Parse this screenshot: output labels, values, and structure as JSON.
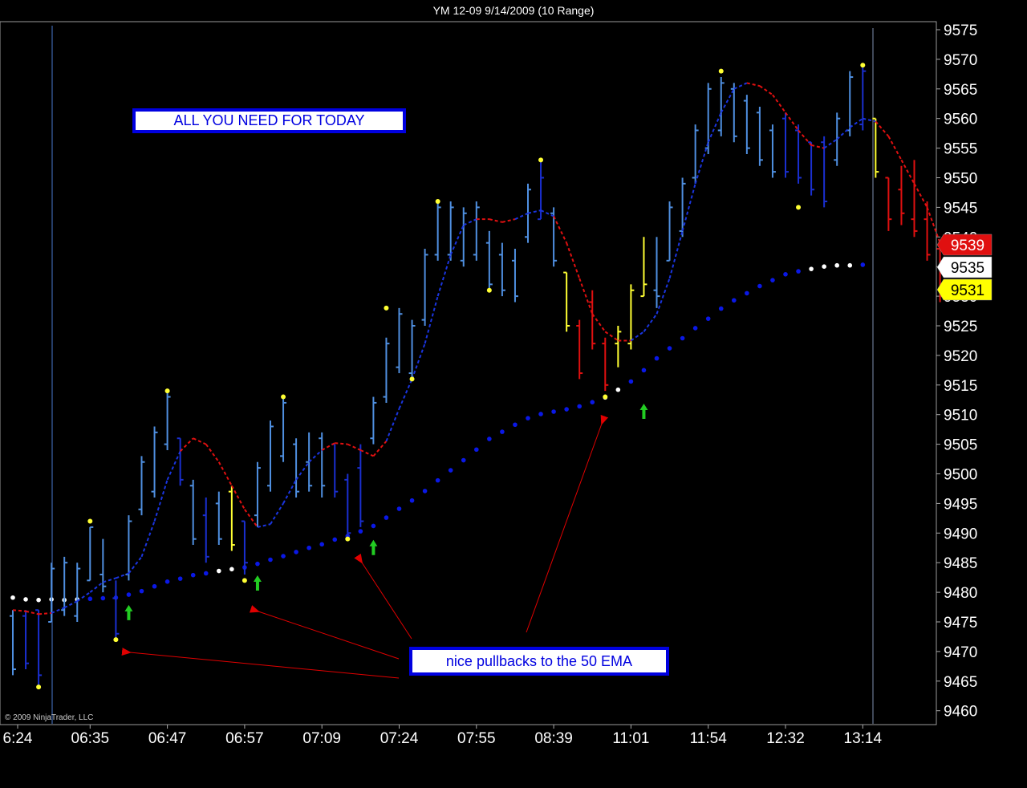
{
  "header": {
    "title": "YM 12-09  9/14/2009 (10 Range)"
  },
  "copyright": "© 2009 NinjaTrader, LLC",
  "annotations": {
    "headline": "ALL YOU NEED FOR TODAY",
    "pullback_note": "nice pullbacks to the 50 EMA"
  },
  "colors": {
    "background": "#000000",
    "up_bar": "#4f8fe0",
    "down_bar": "#1a2fd0",
    "red_bar": "#e01010",
    "yellow_bar": "#ffff33",
    "fast_ma_up": "#1a35e0",
    "fast_ma_down": "#e01010",
    "ema50_dots": "#0a18e6",
    "ema50_flat_dots": "#ffffff",
    "arrow_up": "#22cc22",
    "annotation_arrow": "#e00000",
    "marker_swing": "#ffff33"
  },
  "chart_data": {
    "type": "ohlc",
    "instrument": "YM 12-09",
    "ylim": [
      9460,
      9575
    ],
    "y_ticks": [
      9460,
      9465,
      9470,
      9475,
      9480,
      9485,
      9490,
      9495,
      9500,
      9505,
      9510,
      9515,
      9520,
      9525,
      9530,
      9535,
      9540,
      9545,
      9550,
      9555,
      9560,
      9565,
      9570,
      9575
    ],
    "x_ticks": [
      {
        "label": "6:24",
        "bar": 0
      },
      {
        "label": "06:35",
        "bar": 6
      },
      {
        "label": "06:47",
        "bar": 12
      },
      {
        "label": "06:57",
        "bar": 18
      },
      {
        "label": "07:09",
        "bar": 24
      },
      {
        "label": "07:24",
        "bar": 30
      },
      {
        "label": "07:55",
        "bar": 36
      },
      {
        "label": "08:39",
        "bar": 42
      },
      {
        "label": "11:01",
        "bar": 48
      },
      {
        "label": "11:54",
        "bar": 54
      },
      {
        "label": "12:32",
        "bar": 60
      },
      {
        "label": "13:14",
        "bar": 66
      }
    ],
    "price_markers": [
      {
        "value": 9539,
        "color": "#e01010",
        "text_color": "#ffffff"
      },
      {
        "value": 9535,
        "color": "#ffffff",
        "text_color": "#000000"
      },
      {
        "value": 9531,
        "color": "#ffff00",
        "text_color": "#000000"
      }
    ],
    "bars": [
      {
        "o": 9476,
        "h": 9477,
        "l": 9466,
        "c": 9467,
        "color": "up"
      },
      {
        "o": 9476,
        "h": 9477,
        "l": 9467,
        "c": 9468,
        "color": "down"
      },
      {
        "o": 9477,
        "h": 9477,
        "l": 9464,
        "c": 9466,
        "color": "down"
      },
      {
        "o": 9475,
        "h": 9485,
        "l": 9475,
        "c": 9484,
        "color": "up"
      },
      {
        "o": 9477,
        "h": 9486,
        "l": 9476,
        "c": 9485,
        "color": "up"
      },
      {
        "o": 9476,
        "h": 9485,
        "l": 9475,
        "c": 9484,
        "color": "up"
      },
      {
        "o": 9482,
        "h": 9491,
        "l": 9482,
        "c": 9491,
        "color": "up"
      },
      {
        "o": 9483,
        "h": 9489,
        "l": 9480,
        "c": 9481,
        "color": "up"
      },
      {
        "o": 9479,
        "h": 9482,
        "l": 9472,
        "c": 9473,
        "color": "down"
      },
      {
        "o": 9483,
        "h": 9493,
        "l": 9482,
        "c": 9492,
        "color": "up"
      },
      {
        "o": 9494,
        "h": 9503,
        "l": 9493,
        "c": 9502,
        "color": "up"
      },
      {
        "o": 9497,
        "h": 9508,
        "l": 9496,
        "c": 9507,
        "color": "up"
      },
      {
        "o": 9505,
        "h": 9514,
        "l": 9504,
        "c": 9513,
        "color": "up"
      },
      {
        "o": 9506,
        "h": 9506,
        "l": 9498,
        "c": 9499,
        "color": "down"
      },
      {
        "o": 9498,
        "h": 9499,
        "l": 9488,
        "c": 9489,
        "color": "up"
      },
      {
        "o": 9493,
        "h": 9496,
        "l": 9485,
        "c": 9486,
        "color": "down"
      },
      {
        "o": 9495,
        "h": 9497,
        "l": 9488,
        "c": 9489,
        "color": "up"
      },
      {
        "o": 9497,
        "h": 9498,
        "l": 9487,
        "c": 9488,
        "color": "yellow"
      },
      {
        "o": 9492,
        "h": 9492,
        "l": 9483,
        "c": 9485,
        "color": "down"
      },
      {
        "o": 9493,
        "h": 9502,
        "l": 9491,
        "c": 9501,
        "color": "up"
      },
      {
        "o": 9498,
        "h": 9509,
        "l": 9497,
        "c": 9508,
        "color": "up"
      },
      {
        "o": 9503,
        "h": 9513,
        "l": 9502,
        "c": 9512,
        "color": "up"
      },
      {
        "o": 9505,
        "h": 9506,
        "l": 9496,
        "c": 9497,
        "color": "up"
      },
      {
        "o": 9502,
        "h": 9507,
        "l": 9497,
        "c": 9498,
        "color": "up"
      },
      {
        "o": 9506,
        "h": 9507,
        "l": 9496,
        "c": 9498,
        "color": "up"
      },
      {
        "o": 9505,
        "h": 9505,
        "l": 9496,
        "c": 9497,
        "color": "down"
      },
      {
        "o": 9499,
        "h": 9500,
        "l": 9489,
        "c": 9490,
        "color": "down"
      },
      {
        "o": 9501,
        "h": 9505,
        "l": 9491,
        "c": 9492,
        "color": "down"
      },
      {
        "o": 9506,
        "h": 9513,
        "l": 9505,
        "c": 9512,
        "color": "up"
      },
      {
        "o": 9513,
        "h": 9523,
        "l": 9512,
        "c": 9522,
        "color": "up"
      },
      {
        "o": 9518,
        "h": 9528,
        "l": 9517,
        "c": 9527,
        "color": "up"
      },
      {
        "o": 9517,
        "h": 9526,
        "l": 9516,
        "c": 9525,
        "color": "up"
      },
      {
        "o": 9526,
        "h": 9538,
        "l": 9525,
        "c": 9537,
        "color": "up"
      },
      {
        "o": 9537,
        "h": 9546,
        "l": 9536,
        "c": 9545,
        "color": "up"
      },
      {
        "o": 9537,
        "h": 9546,
        "l": 9536,
        "c": 9545,
        "color": "up"
      },
      {
        "o": 9536,
        "h": 9545,
        "l": 9535,
        "c": 9544,
        "color": "up"
      },
      {
        "o": 9537,
        "h": 9546,
        "l": 9536,
        "c": 9545,
        "color": "up"
      },
      {
        "o": 9539,
        "h": 9541,
        "l": 9531,
        "c": 9532,
        "color": "up"
      },
      {
        "o": 9537,
        "h": 9539,
        "l": 9530,
        "c": 9531,
        "color": "up"
      },
      {
        "o": 9536,
        "h": 9538,
        "l": 9529,
        "c": 9530,
        "color": "up"
      },
      {
        "o": 9540,
        "h": 9549,
        "l": 9539,
        "c": 9548,
        "color": "up"
      },
      {
        "o": 9543,
        "h": 9553,
        "l": 9543,
        "c": 9550,
        "color": "down"
      },
      {
        "o": 9544,
        "h": 9545,
        "l": 9535,
        "c": 9536,
        "color": "up"
      },
      {
        "o": 9534,
        "h": 9534,
        "l": 9524,
        "c": 9525,
        "color": "yellow"
      },
      {
        "o": 9525,
        "h": 9526,
        "l": 9516,
        "c": 9517,
        "color": "red"
      },
      {
        "o": 9529,
        "h": 9531,
        "l": 9521,
        "c": 9522,
        "color": "red"
      },
      {
        "o": 9522,
        "h": 9523,
        "l": 9514,
        "c": 9515,
        "color": "red"
      },
      {
        "o": 9522,
        "h": 9525,
        "l": 9518,
        "c": 9524,
        "color": "yellow"
      },
      {
        "o": 9522,
        "h": 9532,
        "l": 9521,
        "c": 9531,
        "color": "yellow"
      },
      {
        "o": 9530,
        "h": 9540,
        "l": 9530,
        "c": 9532,
        "color": "yellow"
      },
      {
        "o": 9531,
        "h": 9540,
        "l": 9528,
        "c": 9530,
        "color": "up"
      },
      {
        "o": 9536,
        "h": 9546,
        "l": 9536,
        "c": 9545,
        "color": "up"
      },
      {
        "o": 9541,
        "h": 9550,
        "l": 9540,
        "c": 9549,
        "color": "up"
      },
      {
        "o": 9550,
        "h": 9559,
        "l": 9549,
        "c": 9558,
        "color": "up"
      },
      {
        "o": 9555,
        "h": 9566,
        "l": 9554,
        "c": 9565,
        "color": "up"
      },
      {
        "o": 9558,
        "h": 9567,
        "l": 9557,
        "c": 9566,
        "color": "up"
      },
      {
        "o": 9565,
        "h": 9566,
        "l": 9556,
        "c": 9557,
        "color": "up"
      },
      {
        "o": 9563,
        "h": 9564,
        "l": 9554,
        "c": 9555,
        "color": "up"
      },
      {
        "o": 9561,
        "h": 9562,
        "l": 9552,
        "c": 9553,
        "color": "up"
      },
      {
        "o": 9558,
        "h": 9559,
        "l": 9550,
        "c": 9551,
        "color": "up"
      },
      {
        "o": 9560,
        "h": 9561,
        "l": 9550,
        "c": 9551,
        "color": "down"
      },
      {
        "o": 9558,
        "h": 9559,
        "l": 9549,
        "c": 9550,
        "color": "down"
      },
      {
        "o": 9556,
        "h": 9556,
        "l": 9547,
        "c": 9548,
        "color": "down"
      },
      {
        "o": 9556,
        "h": 9557,
        "l": 9545,
        "c": 9546,
        "color": "down"
      },
      {
        "o": 9553,
        "h": 9561,
        "l": 9552,
        "c": 9560,
        "color": "up"
      },
      {
        "o": 9558,
        "h": 9568,
        "l": 9557,
        "c": 9567,
        "color": "up"
      },
      {
        "o": 9559,
        "h": 9569,
        "l": 9558,
        "c": 9568,
        "color": "down"
      },
      {
        "o": 9560,
        "h": 9560,
        "l": 9550,
        "c": 9551,
        "color": "yellow"
      },
      {
        "o": 9550,
        "h": 9550,
        "l": 9541,
        "c": 9543,
        "color": "red"
      },
      {
        "o": 9548,
        "h": 9552,
        "l": 9542,
        "c": 9544,
        "color": "red"
      },
      {
        "o": 9543,
        "h": 9553,
        "l": 9540,
        "c": 9541,
        "color": "red"
      },
      {
        "o": 9543,
        "h": 9546,
        "l": 9536,
        "c": 9537,
        "color": "red"
      },
      {
        "o": 9538,
        "h": 9538,
        "l": 9529,
        "c": 9530,
        "color": "red"
      }
    ],
    "fast_ma": [
      9477,
      9476.8,
      9476.3,
      9476.5,
      9477.4,
      9478.5,
      9480,
      9481.7,
      9482.4,
      9483.2,
      9486,
      9492,
      9499,
      9503.8,
      9506,
      9505,
      9502,
      9498,
      9494,
      9491,
      9491.5,
      9495,
      9499,
      9502,
      9504,
      9505.2,
      9505,
      9504,
      9503,
      9505.5,
      9511,
      9516,
      9522,
      9530,
      9537,
      9542,
      9543,
      9543,
      9542.5,
      9543,
      9544,
      9544.5,
      9543.5,
      9539,
      9533,
      9527,
      9524,
      9522.5,
      9522.5,
      9524,
      9527,
      9533,
      9541,
      9549,
      9556,
      9561,
      9565,
      9566,
      9565.5,
      9564,
      9561,
      9558,
      9555.5,
      9555,
      9556.5,
      9558.5,
      9560,
      9559.5,
      9557,
      9553,
      9549,
      9545,
      9539
    ],
    "fast_ma_colors": [
      "red",
      "red",
      "red",
      "up",
      "up",
      "up",
      "up",
      "up",
      "up",
      "up",
      "up",
      "up",
      "up",
      "red",
      "red",
      "red",
      "red",
      "red",
      "red",
      "up",
      "up",
      "up",
      "up",
      "up",
      "red",
      "red",
      "red",
      "red",
      "red",
      "up",
      "up",
      "up",
      "up",
      "up",
      "up",
      "up",
      "red",
      "red",
      "red",
      "up",
      "up",
      "up",
      "red",
      "red",
      "red",
      "red",
      "red",
      "red",
      "up",
      "up",
      "up",
      "up",
      "up",
      "up",
      "up",
      "up",
      "up",
      "red",
      "red",
      "red",
      "red",
      "red",
      "red",
      "up",
      "up",
      "up",
      "up",
      "red",
      "red",
      "red",
      "red",
      "red",
      "red"
    ],
    "ema50": [
      9479.1,
      9478.8,
      9478.7,
      9478.8,
      9478.7,
      9478.8,
      9478.9,
      9479,
      9479.1,
      9479.6,
      9480.2,
      9481,
      9481.8,
      9482.3,
      9482.9,
      9483.2,
      9483.6,
      9483.9,
      9484.2,
      9484.8,
      9485.5,
      9486.1,
      9486.8,
      9487.5,
      9488.1,
      9488.9,
      9489.5,
      9490.3,
      9491.2,
      9492.6,
      9494.1,
      9495.5,
      9497.1,
      9498.9,
      9500.6,
      9502.3,
      9504.1,
      9505.9,
      9507.1,
      9508.3,
      9509.4,
      9510.1,
      9510.5,
      9510.9,
      9511.4,
      9512.1,
      9512.9,
      9514.2,
      9515.6,
      9517.5,
      9519.5,
      9521.2,
      9522.9,
      9524.6,
      9526.2,
      9527.9,
      9529.3,
      9530.5,
      9531.7,
      9532.7,
      9533.7,
      9534.2,
      9534.6,
      9535,
      9535.2,
      9535.2,
      9535.3
    ],
    "ema50_flat_indices": [
      0,
      1,
      2,
      3,
      4,
      5,
      16,
      17,
      46,
      47,
      62,
      63,
      64,
      65
    ],
    "swing_markers": [
      {
        "bar": 2,
        "value": 9464
      },
      {
        "bar": 6,
        "value": 9492
      },
      {
        "bar": 8,
        "value": 9472
      },
      {
        "bar": 12,
        "value": 9514
      },
      {
        "bar": 18,
        "value": 9482
      },
      {
        "bar": 21,
        "value": 9513
      },
      {
        "bar": 26,
        "value": 9489
      },
      {
        "bar": 29,
        "value": 9528
      },
      {
        "bar": 31,
        "value": 9516
      },
      {
        "bar": 33,
        "value": 9546
      },
      {
        "bar": 37,
        "value": 9531
      },
      {
        "bar": 41,
        "value": 9553
      },
      {
        "bar": 46,
        "value": 9513
      },
      {
        "bar": 55,
        "value": 9568
      },
      {
        "bar": 61,
        "value": 9545
      },
      {
        "bar": 66,
        "value": 9569
      }
    ],
    "up_arrows": [
      {
        "bar": 9,
        "value": 9476.5
      },
      {
        "bar": 19,
        "value": 9481.5
      },
      {
        "bar": 28,
        "value": 9487.5
      },
      {
        "bar": 49,
        "value": 9510.5
      }
    ]
  }
}
